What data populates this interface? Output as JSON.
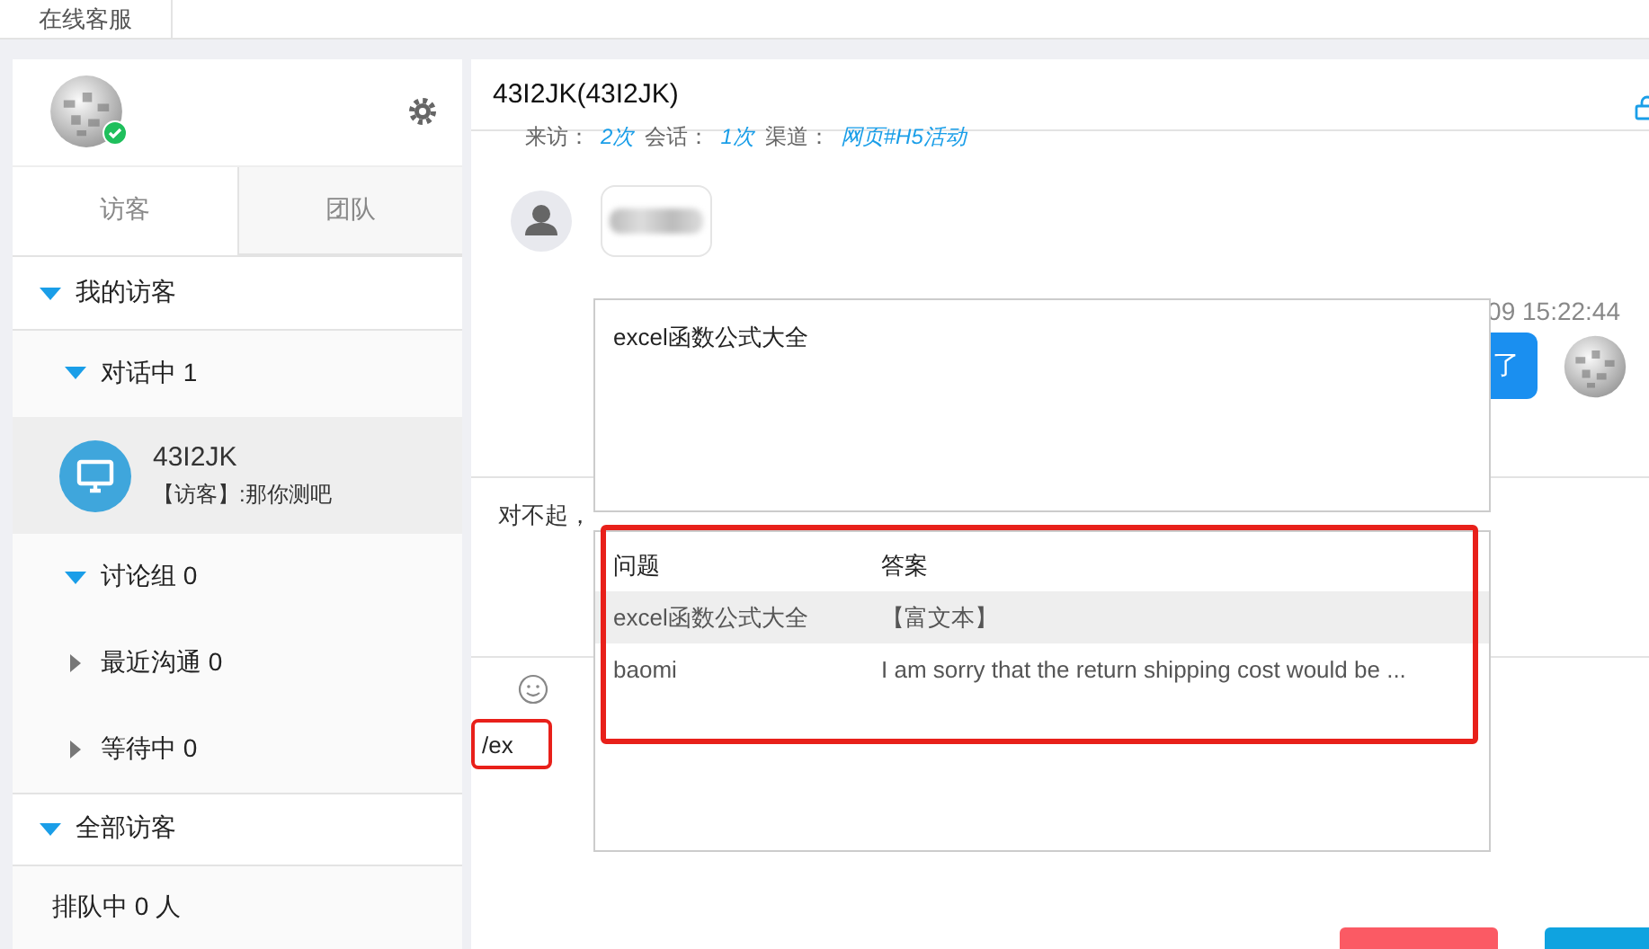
{
  "top_tabs": [
    {
      "label": "在线客服",
      "selected": true
    }
  ],
  "agent": {
    "online": true
  },
  "sidebar": {
    "tabs": [
      {
        "label": "访客",
        "selected": true
      },
      {
        "label": "团队",
        "selected": false
      }
    ],
    "groups": [
      {
        "label": "我的访客",
        "expanded": true,
        "children": [
          {
            "label": "对话中 1",
            "expanded": true,
            "visitors": [
              {
                "name": "43I2JK",
                "last_message": "【访客】:那你测吧",
                "selected": true
              }
            ]
          },
          {
            "label": "讨论组 0",
            "expanded": true
          },
          {
            "label": "最近沟通 0",
            "expanded": false
          },
          {
            "label": "等待中 0",
            "expanded": false
          }
        ]
      },
      {
        "label": "全部访客",
        "expanded": true,
        "summary": "排队中 0 人"
      }
    ]
  },
  "chat": {
    "title": "43I2JK(43I2JK)",
    "stats": [
      {
        "label": "来访：",
        "value": "2次"
      },
      {
        "label": "会话：",
        "value": "1次"
      },
      {
        "label": "渠道：",
        "value": "网页#H5活动"
      }
    ],
    "messages": [
      {
        "kind": "visitor"
      },
      {
        "kind": "agent",
        "time": "09 15:22:44",
        "text": "了"
      }
    ],
    "reply_line": "对不起，",
    "composer": {
      "value": "/ex",
      "highlighted": true
    },
    "buttons": [
      {
        "kind": "end"
      },
      {
        "kind": "send"
      }
    ]
  },
  "quick_reply": {
    "preview": "excel函数公式大全",
    "highlighted": true,
    "columns": [
      "问题",
      "答案"
    ],
    "rows": [
      {
        "question": "excel函数公式大全",
        "answer": "【富文本】",
        "selected": true
      },
      {
        "question": "baomi",
        "answer": "I am sorry that the return shipping cost would be ...",
        "selected": false
      }
    ]
  }
}
